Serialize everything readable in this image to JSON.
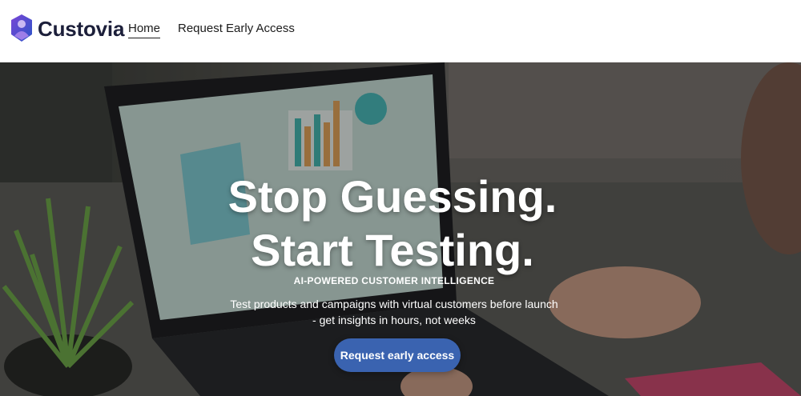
{
  "header": {
    "brand": "Custovia",
    "nav": [
      {
        "label": "Home",
        "active": true
      },
      {
        "label": "Request Early Access",
        "active": false
      }
    ]
  },
  "hero": {
    "headline_line1": "Stop Guessing.",
    "headline_line2": "Start Testing.",
    "tagline": "AI-POWERED CUSTOMER INTELLIGENCE",
    "subtitle_line1": "Test products and campaigns with virtual customers before launch",
    "subtitle_line2": "- get insights in hours, not weeks",
    "cta_label": "Request early access"
  },
  "colors": {
    "brand_text": "#1c1f3a",
    "logo_purple": "#6a3fc8",
    "logo_blue": "#2b55c8",
    "cta": "#3a63b0"
  },
  "icons": {
    "logo": "custovia-shield-person-icon"
  }
}
